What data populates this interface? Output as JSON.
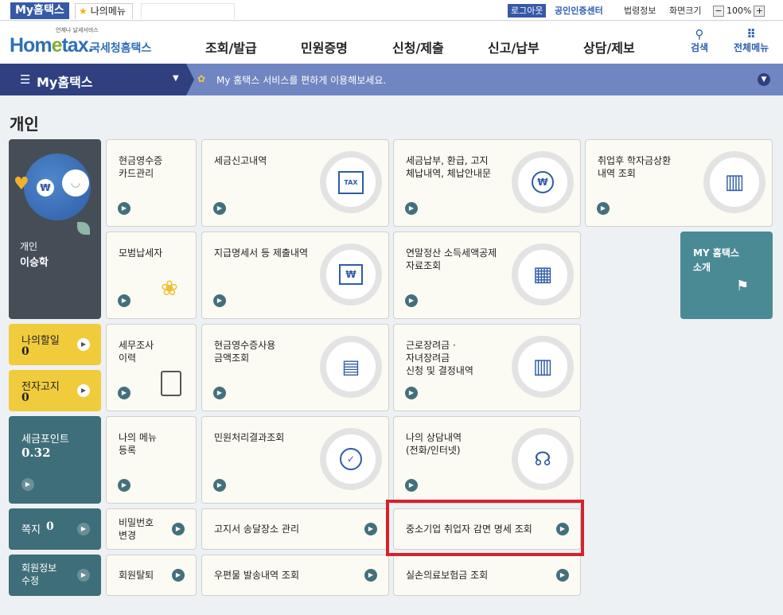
{
  "topstrip": {
    "tab_my": "My홈택스",
    "tab_mymenu": "나의메뉴",
    "login": "로그아웃",
    "cert": "공인인증센터",
    "law": "법령정보",
    "size_label": "화면크기",
    "zoom_value": "100%"
  },
  "header": {
    "logo_small": "언제나 날세서비스",
    "logo_main_a": "Hom",
    "logo_main_e": "e",
    "logo_main_b": "tax.",
    "logo_sub": "국세청홈택스",
    "nav": [
      "조회/발급",
      "민원증명",
      "신청/제출",
      "신고/납부",
      "상담/제보"
    ],
    "search_label": "검색",
    "allmenu_label": "전체메뉴"
  },
  "bar": {
    "title": "My홈택스",
    "message": "My 홈택스 서비스를 편하게 이용해보세요."
  },
  "section_title": "개인",
  "profile": {
    "type": "개인",
    "name": "이승학"
  },
  "todo": {
    "label": "나의할일",
    "count": "0"
  },
  "notice": {
    "label": "전자고지",
    "count": "0"
  },
  "points": {
    "label": "세금포인트",
    "value": "0.32"
  },
  "memo": {
    "label": "쪽지",
    "count": "0"
  },
  "member": {
    "label": "회원정보\n수정"
  },
  "my_intro": {
    "label": "MY 홈택스\n소개"
  },
  "cards": {
    "c1": "현금영수증\n카드관리",
    "c2": "세금신고내역",
    "c3": "세금납부, 환급, 고지\n체납내역, 체납안내문",
    "c4": "취업후 학자금상환\n내역 조회",
    "c5": "모범납세자",
    "c6": "지급명세서 등 제출내역",
    "c7": "연말정산 소득세액공제\n자료조회",
    "c8": "세무조사\n이력",
    "c9": "현금영수증사용\n금액조회",
    "c10": "근로장려금 ·\n자녀장려금\n신청 및 결정내역",
    "c11": "나의 메뉴\n등록",
    "c12": "민원처리결과조회",
    "c13": "나의 상담내역\n(전화/인터넷)",
    "s1": "비밀번호\n변경",
    "s2": "고지서 송달장소 관리",
    "s3": "중소기업 취업자 감면 명세 조회",
    "s4": "회원탈퇴",
    "s5": "우편물 발송내역 조회",
    "s6": "실손의료보험금 조회"
  },
  "icons": {
    "tax_doc": "TAX",
    "won": "₩"
  }
}
